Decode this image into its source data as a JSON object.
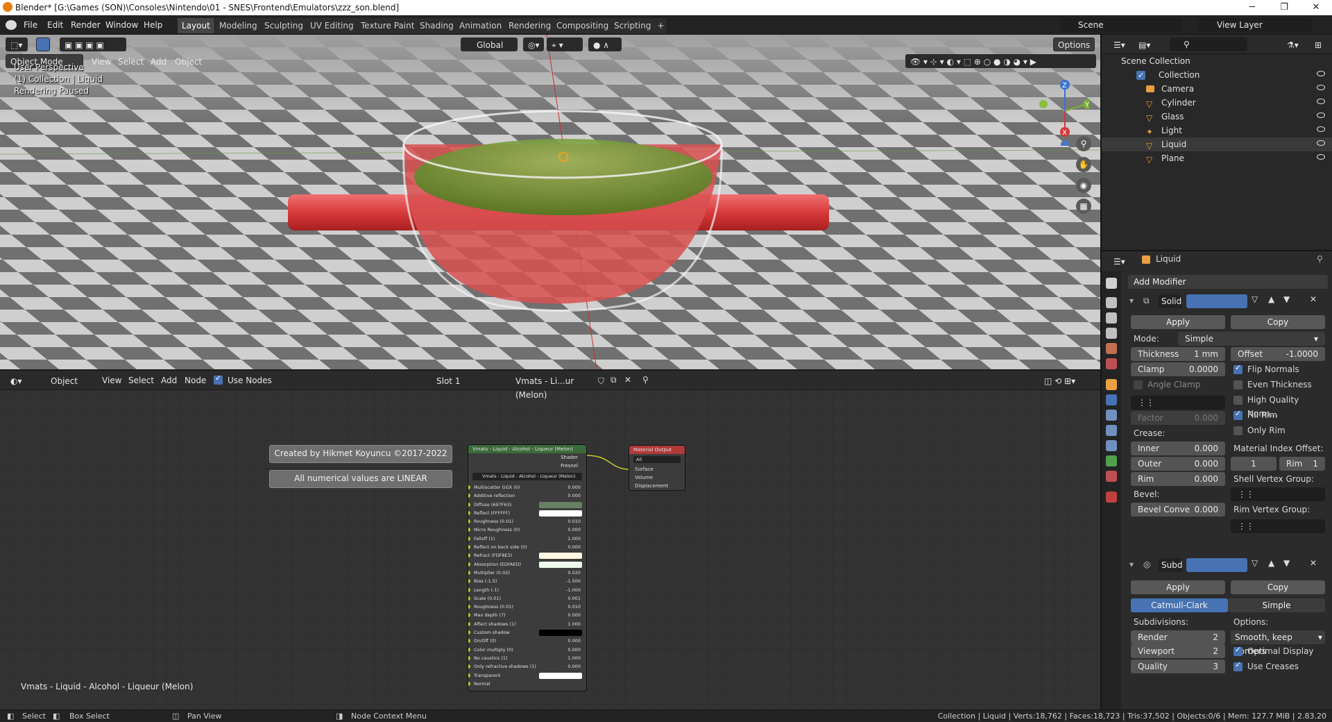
{
  "window": {
    "title": "Blender* [G:\\Games (SON)\\Consoles\\Nintendo\\01 - SNES\\Frontend\\Emulators\\zzz_son.blend]"
  },
  "menus": [
    "File",
    "Edit",
    "Render",
    "Window",
    "Help"
  ],
  "workspaces": [
    "Layout",
    "Modeling",
    "Sculpting",
    "UV Editing",
    "Texture Paint",
    "Shading",
    "Animation",
    "Rendering",
    "Compositing",
    "Scripting"
  ],
  "scene": {
    "label": "Scene",
    "view_layer": "View Layer"
  },
  "viewport": {
    "mode": "Object Mode",
    "menus": [
      "View",
      "Select",
      "Add",
      "Object"
    ],
    "transform": "Global",
    "options": "Options",
    "overlay": [
      "User Perspective",
      "(1) Collection | Liquid",
      "Rendering Paused"
    ]
  },
  "node_editor": {
    "editor_type": "Object",
    "menus": [
      "View",
      "Select",
      "Add",
      "Node"
    ],
    "use_nodes": "Use Nodes",
    "slot": "Slot 1",
    "material": "Vmats - Li...ur (Melon)",
    "frame_credit": "Created by Hikmet Koyuncu ©2017-2022",
    "frame_note": "All numerical values are LINEAR",
    "material_label": "Vmats - Liquid - Alcohol - Liqueur (Melon)",
    "group_node": {
      "title": "Vmats - Liquid - Alcohol - Liqueur (Melon)",
      "outputs": [
        "Shader",
        "Fresnel"
      ],
      "group_name": "Vmats - Liquid - Alcohol - Liqueur (Melon)",
      "rows": [
        {
          "label": "Multiscatter GGX (0)",
          "value": "0.000"
        },
        {
          "label": "Additive reflection",
          "value": "0.000"
        },
        {
          "label": "Diffuse (697F63)",
          "color": "#697F63"
        },
        {
          "label": "Reflect (FFFFFF)",
          "color": "#FFFFFF"
        },
        {
          "label": "Roughness (0.01)",
          "value": "0.010"
        },
        {
          "label": "Micro Roughness (0)",
          "value": "0.000"
        },
        {
          "label": "Falloff (1)",
          "value": "1.000"
        },
        {
          "label": "Reflect on back side (0)",
          "value": "0.000"
        },
        {
          "label": "Refract (FDF8E3)",
          "color": "#FDF8E3"
        },
        {
          "label": "Absorption (EDFAED)",
          "color": "#EDFAED"
        },
        {
          "label": "Multiplier (0.02)",
          "value": "0.020"
        },
        {
          "label": "Bias (-1.5)",
          "value": "-1.500"
        },
        {
          "label": "Length (-1)",
          "value": "-1.000"
        },
        {
          "label": "Scale (0.01)",
          "value": "0.001"
        },
        {
          "label": "Roughness (0.01)",
          "value": "0.010"
        },
        {
          "label": "Max depth (7)",
          "value": "0.000"
        },
        {
          "label": "Affect shadows (1)",
          "value": "1.000"
        },
        {
          "label": "Custom shadow",
          "color": "#000000"
        },
        {
          "label": "On/Off (0)",
          "value": "0.000"
        },
        {
          "label": "Color multiply (0)",
          "value": "0.000"
        },
        {
          "label": "No caustics (1)",
          "value": "1.000"
        },
        {
          "label": "Only refractive shadows (1)",
          "value": "0.000"
        },
        {
          "label": "Transparent",
          "color": "#FFFFFF"
        },
        {
          "label": "Normal",
          "value": ""
        }
      ]
    },
    "output_node": {
      "title": "Material Output",
      "target": "All",
      "inputs": [
        "Surface",
        "Volume",
        "Displacement"
      ]
    }
  },
  "outliner": {
    "root": "Scene Collection",
    "collection": "Collection",
    "items": [
      "Camera",
      "Cylinder",
      "Glass",
      "Light",
      "Liquid",
      "Plane"
    ]
  },
  "properties": {
    "object": "Liquid",
    "add_modifier": "Add Modifier",
    "solidify": {
      "name": "Solid",
      "apply": "Apply",
      "copy": "Copy",
      "mode_label": "Mode:",
      "mode": "Simple",
      "thickness_label": "Thickness",
      "thickness": "1 mm",
      "offset_label": "Offset",
      "offset": "-1.0000",
      "clamp_label": "Clamp",
      "clamp": "0.0000",
      "angle_clamp": "Angle Clamp",
      "factor_label": "Factor",
      "factor": "0.000",
      "flip_normals": "Flip Normals",
      "even_thickness": "Even Thickness",
      "high_quality": "High Quality Norm...",
      "fill_rim": "Fill Rim",
      "only_rim": "Only Rim",
      "crease_label": "Crease:",
      "inner_label": "Inner",
      "inner": "0.000",
      "outer_label": "Outer",
      "outer": "0.000",
      "rim_label": "Rim",
      "rim": "0.000",
      "mat_offset_label": "Material Index Offset:",
      "mat_offset": "1",
      "mat_rim_label": "Rim",
      "mat_rim": "1",
      "shell_vg": "Shell Vertex Group:",
      "bevel_label": "Bevel:",
      "bevel_convex_label": "Bevel Conve",
      "bevel_convex": "0.000",
      "rim_vg": "Rim Vertex Group:"
    },
    "subsurf": {
      "name": "Subd",
      "apply": "Apply",
      "copy": "Copy",
      "type_a": "Catmull-Clark",
      "type_b": "Simple",
      "subdivisions_label": "Subdivisions:",
      "render_label": "Render",
      "render": "2",
      "viewport_label": "Viewport",
      "viewport": "2",
      "quality_label": "Quality",
      "quality": "3",
      "options_label": "Options:",
      "uv_smooth": "Smooth, keep corners",
      "optimal_display": "Optimal Display",
      "use_creases": "Use Creases"
    }
  },
  "statusbar": {
    "select": "Select",
    "box_select": "Box Select",
    "pan": "Pan View",
    "context": "Node Context Menu",
    "stats": "Collection | Liquid | Verts:18,762 | Faces:18,723 | Tris:37,502 | Objects:0/6 | Mem: 127.7 MiB | 2.83.20"
  },
  "colors": {
    "accent": "#4772b3",
    "active_tab": "#464646",
    "panel": "#2b2b2b"
  }
}
